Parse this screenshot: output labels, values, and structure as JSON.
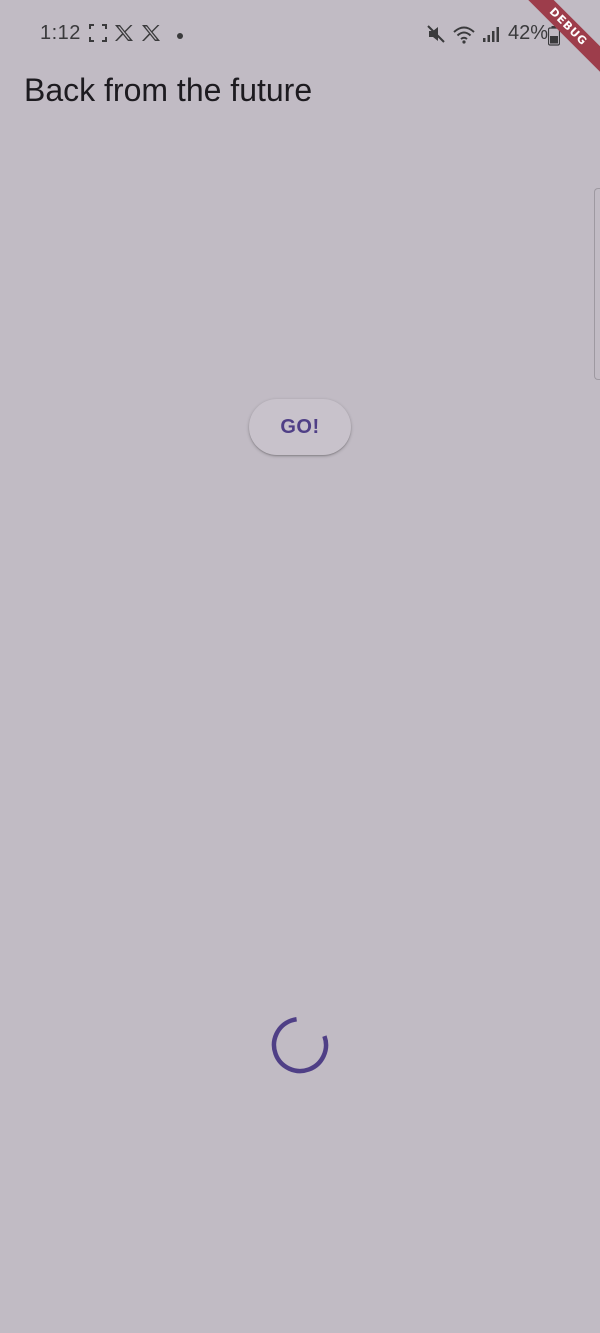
{
  "status_bar": {
    "time": "1:12",
    "battery_percent": "42%",
    "left_icons": [
      "screenshot-icon",
      "x-logo-icon",
      "x-logo-icon",
      "notification-dot-icon"
    ],
    "right_icons": [
      "mute-icon",
      "wifi-icon",
      "signal-icon",
      "battery-icon"
    ]
  },
  "debug_banner": {
    "label": "DEBUG"
  },
  "app_bar": {
    "title": "Back from the future"
  },
  "main": {
    "go_button_label": "GO!"
  },
  "colors": {
    "background": "#c1bbc4",
    "accent": "#4f3f86",
    "debug_banner": "#9d3d4b"
  }
}
